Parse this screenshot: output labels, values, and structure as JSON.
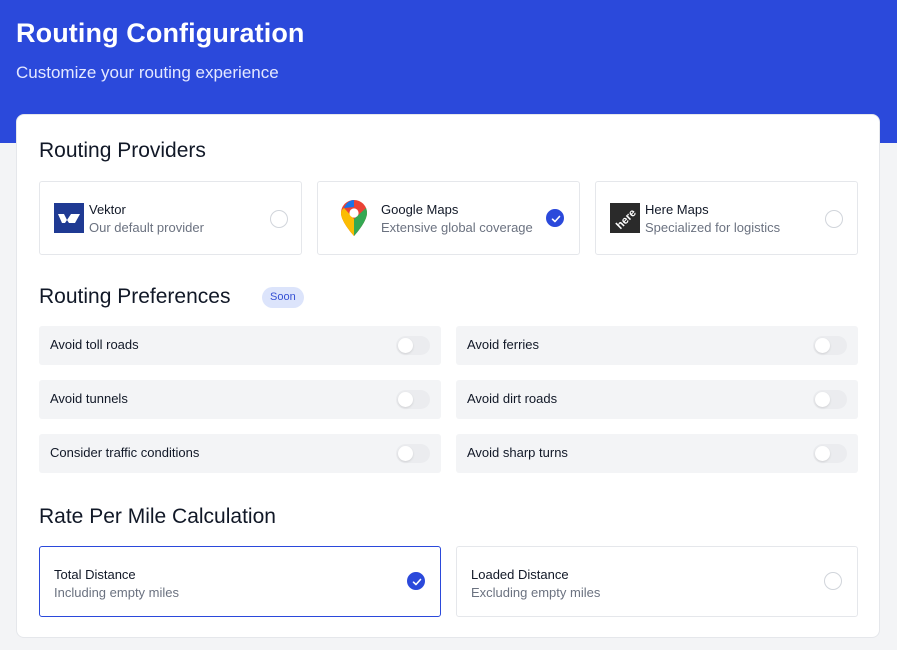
{
  "header": {
    "title": "Routing Configuration",
    "subtitle": "Customize your routing experience"
  },
  "providers_section": {
    "title": "Routing Providers",
    "items": [
      {
        "name": "Vektor",
        "description": "Our default provider",
        "icon": "vektor-logo-icon",
        "selected": false
      },
      {
        "name": "Google Maps",
        "description": "Extensive global coverage",
        "icon": "google-maps-pin-icon",
        "selected": true
      },
      {
        "name": "Here Maps",
        "description": "Specialized for logistics",
        "icon": "here-maps-logo-icon",
        "selected": false
      }
    ]
  },
  "preferences_section": {
    "title": "Routing Preferences",
    "badge": "Soon",
    "items": [
      {
        "label": "Avoid toll roads",
        "enabled": false
      },
      {
        "label": "Avoid ferries",
        "enabled": false
      },
      {
        "label": "Avoid tunnels",
        "enabled": false
      },
      {
        "label": "Avoid dirt roads",
        "enabled": false
      },
      {
        "label": "Consider traffic conditions",
        "enabled": false
      },
      {
        "label": "Avoid sharp turns",
        "enabled": false
      }
    ]
  },
  "rate_section": {
    "title": "Rate Per Mile Calculation",
    "options": [
      {
        "name": "Total Distance",
        "description": "Including empty miles",
        "selected": true
      },
      {
        "name": "Loaded Distance",
        "description": "Excluding empty miles",
        "selected": false
      }
    ]
  },
  "colors": {
    "accent": "#2b49db",
    "badge_bg": "#dce4fb",
    "row_bg": "#f3f4f6"
  }
}
